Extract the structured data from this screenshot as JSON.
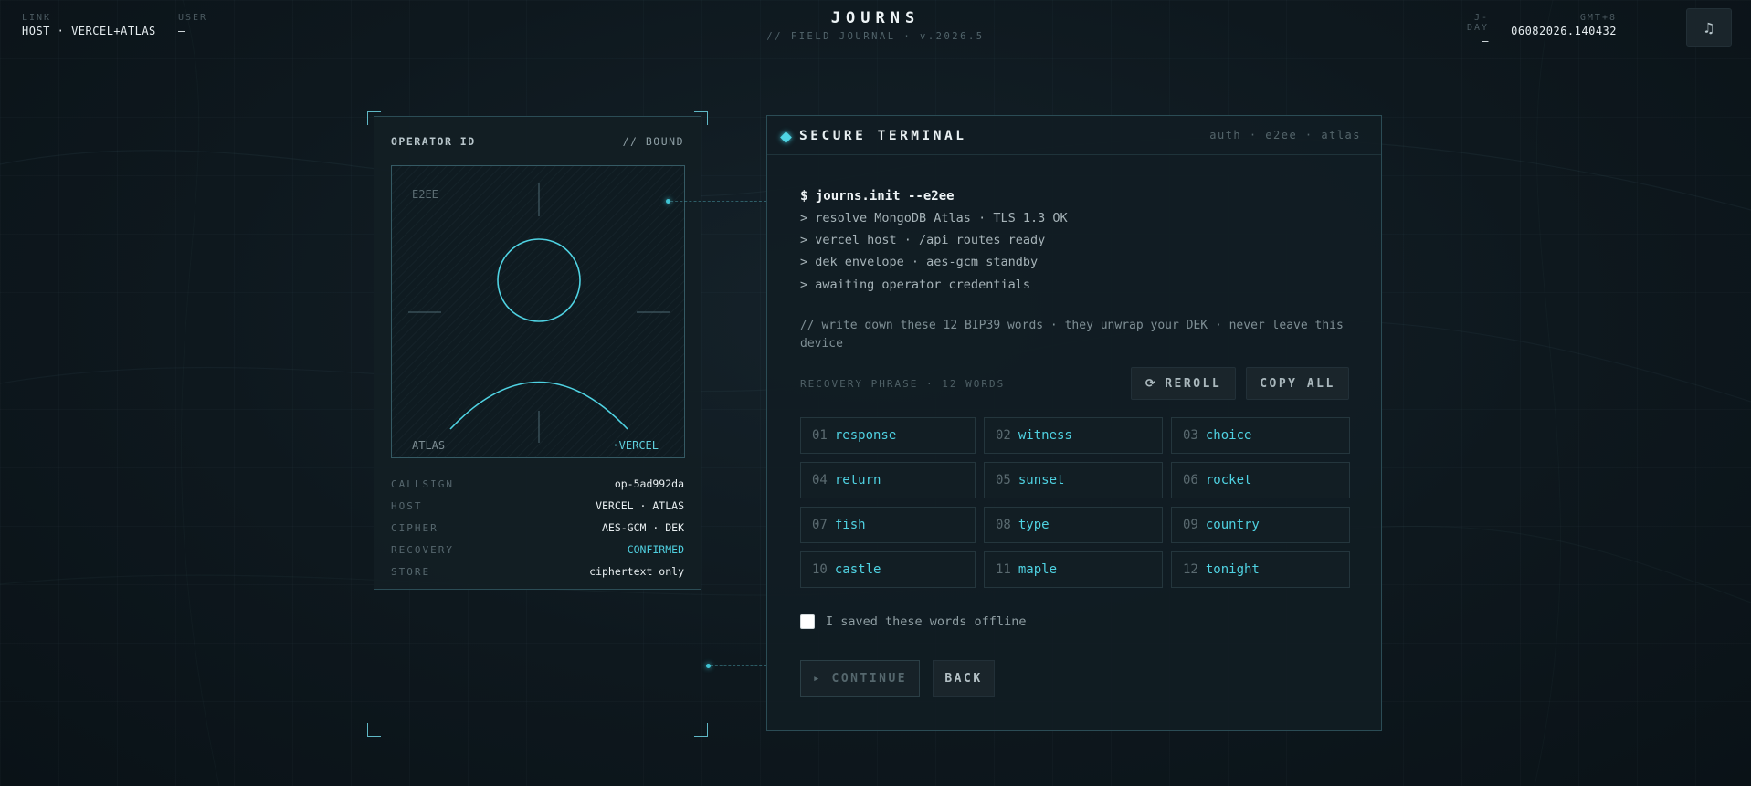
{
  "topbar": {
    "link_label": "LINK",
    "link_value": "HOST · VERCEL+ATLAS",
    "user_label": "USER",
    "user_value": "—",
    "brand_title": "JOURNS",
    "brand_sub": "// FIELD JOURNAL · v.2026.5",
    "jday_label": "J-DAY",
    "jday_value": "—",
    "gmt_label": "GMT+8",
    "gmt_value": "06082026.140432",
    "music_icon": "music-note-icon"
  },
  "operator": {
    "title": "OPERATOR ID",
    "status": "// BOUND",
    "portrait": {
      "tag_top": "E2EE",
      "tag_left": "ATLAS",
      "tag_right": "·VERCEL"
    },
    "rows": [
      {
        "key": "CALLSIGN",
        "value": "op-5ad992da"
      },
      {
        "key": "HOST",
        "value": "VERCEL · ATLAS"
      },
      {
        "key": "CIPHER",
        "value": "AES-GCM · DEK"
      },
      {
        "key": "RECOVERY",
        "value": "CONFIRMED"
      },
      {
        "key": "STORE",
        "value": "ciphertext only"
      }
    ]
  },
  "terminal": {
    "title": "SECURE TERMINAL",
    "tags": "auth · e2ee · atlas",
    "command": "$ journs.init --e2ee",
    "log": [
      "> resolve MongoDB Atlas · TLS 1.3 OK",
      "> vercel host · /api routes ready",
      "> dek envelope · aes-gcm standby",
      "> awaiting operator credentials"
    ],
    "note": "// write down these 12 BIP39 words · they unwrap your DEK · never leave this device",
    "recovery_label": "RECOVERY PHRASE · 12 WORDS",
    "reroll_label": "REROLL",
    "copy_all_label": "COPY ALL",
    "words": [
      {
        "num": "01",
        "word": "response"
      },
      {
        "num": "02",
        "word": "witness"
      },
      {
        "num": "03",
        "word": "choice"
      },
      {
        "num": "04",
        "word": "return"
      },
      {
        "num": "05",
        "word": "sunset"
      },
      {
        "num": "06",
        "word": "rocket"
      },
      {
        "num": "07",
        "word": "fish"
      },
      {
        "num": "08",
        "word": "type"
      },
      {
        "num": "09",
        "word": "country"
      },
      {
        "num": "10",
        "word": "castle"
      },
      {
        "num": "11",
        "word": "maple"
      },
      {
        "num": "12",
        "word": "tonight"
      }
    ],
    "checkbox_label": "I saved these words offline",
    "continue_label": "▸ CONTINUE",
    "back_label": "BACK"
  },
  "colors": {
    "accent": "#4fd2e2",
    "background": "#0e181e",
    "panel_border": "#2b4c55"
  }
}
